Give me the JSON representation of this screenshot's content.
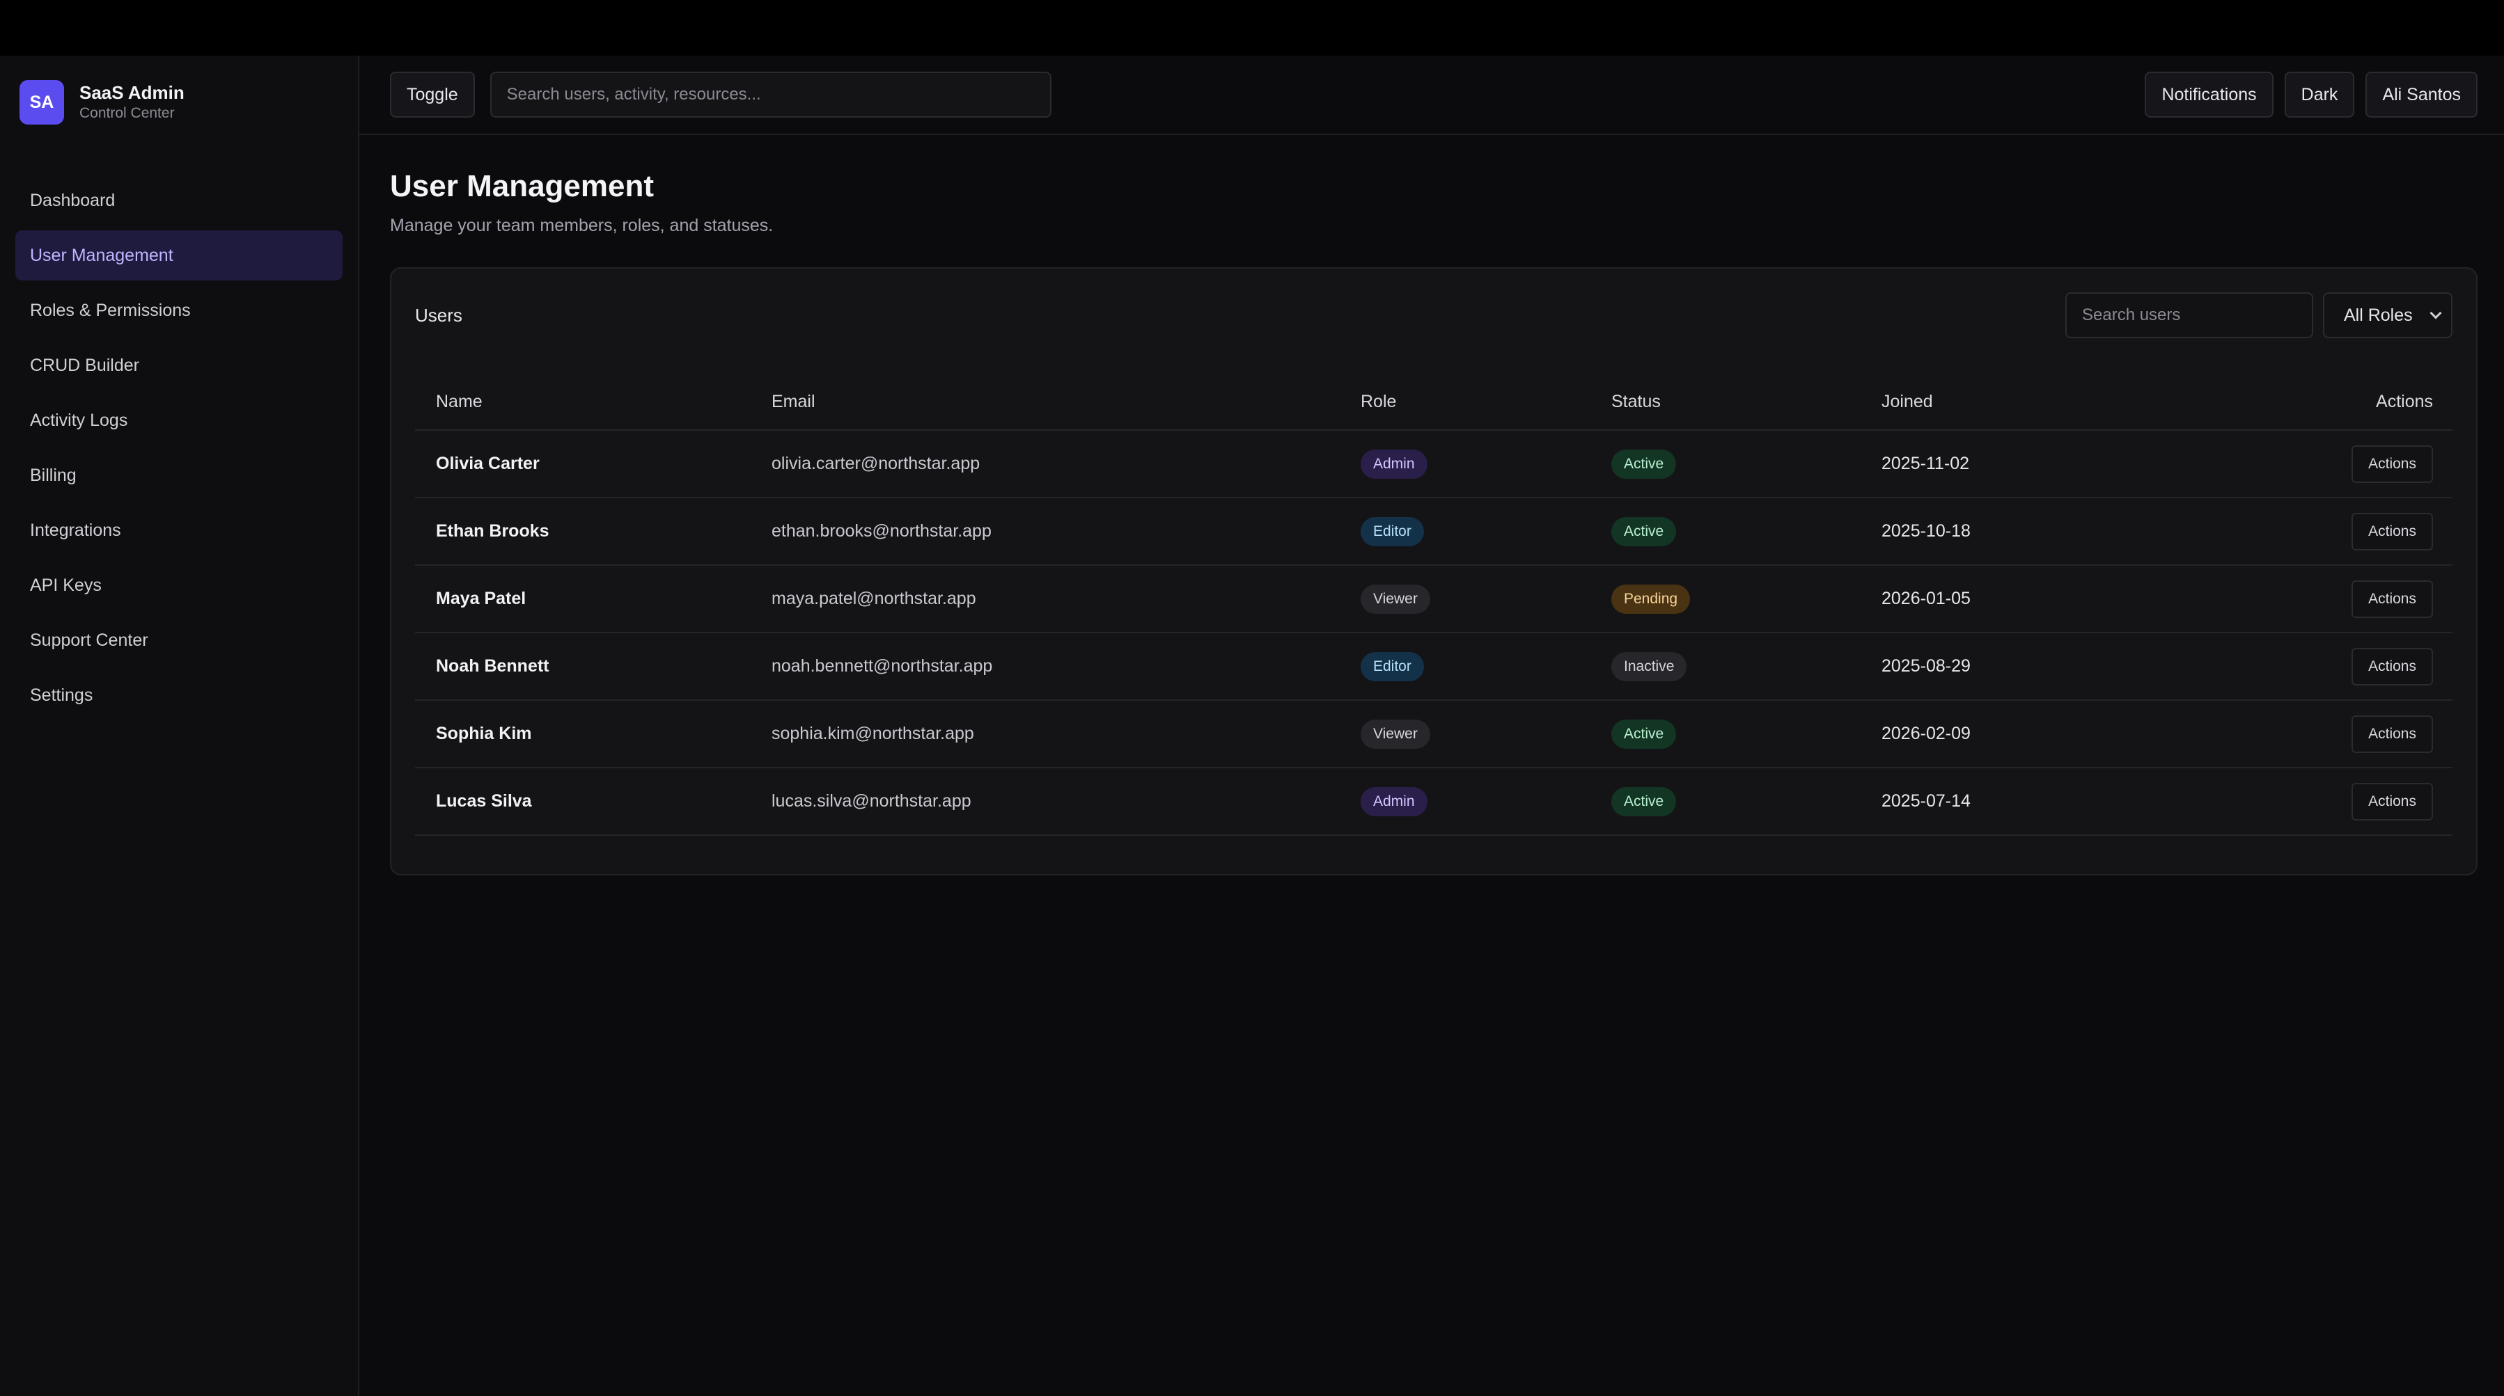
{
  "brand": {
    "logo": "SA",
    "title": "SaaS Admin",
    "subtitle": "Control Center"
  },
  "sidebar": {
    "items": [
      {
        "label": "Dashboard",
        "active": false
      },
      {
        "label": "User Management",
        "active": true
      },
      {
        "label": "Roles & Permissions",
        "active": false
      },
      {
        "label": "CRUD Builder",
        "active": false
      },
      {
        "label": "Activity Logs",
        "active": false
      },
      {
        "label": "Billing",
        "active": false
      },
      {
        "label": "Integrations",
        "active": false
      },
      {
        "label": "API Keys",
        "active": false
      },
      {
        "label": "Support Center",
        "active": false
      },
      {
        "label": "Settings",
        "active": false
      }
    ]
  },
  "header": {
    "toggle_label": "Toggle",
    "search_placeholder": "Search users, activity, resources...",
    "notifications_label": "Notifications",
    "theme_label": "Dark",
    "user_label": "Ali Santos"
  },
  "page": {
    "title": "User Management",
    "subtitle": "Manage your team members, roles, and statuses."
  },
  "card": {
    "title": "Users",
    "search_placeholder": "Search users",
    "role_filter": "All Roles"
  },
  "table": {
    "columns": [
      "Name",
      "Email",
      "Role",
      "Status",
      "Joined",
      "Actions"
    ],
    "rows": [
      {
        "name": "Olivia Carter",
        "email": "olivia.carter@northstar.app",
        "role": "Admin",
        "status": "Active",
        "joined": "2025-11-02",
        "action": "Actions"
      },
      {
        "name": "Ethan Brooks",
        "email": "ethan.brooks@northstar.app",
        "role": "Editor",
        "status": "Active",
        "joined": "2025-10-18",
        "action": "Actions"
      },
      {
        "name": "Maya Patel",
        "email": "maya.patel@northstar.app",
        "role": "Viewer",
        "status": "Pending",
        "joined": "2026-01-05",
        "action": "Actions"
      },
      {
        "name": "Noah Bennett",
        "email": "noah.bennett@northstar.app",
        "role": "Editor",
        "status": "Inactive",
        "joined": "2025-08-29",
        "action": "Actions"
      },
      {
        "name": "Sophia Kim",
        "email": "sophia.kim@northstar.app",
        "role": "Viewer",
        "status": "Active",
        "joined": "2026-02-09",
        "action": "Actions"
      },
      {
        "name": "Lucas Silva",
        "email": "lucas.silva@northstar.app",
        "role": "Admin",
        "status": "Active",
        "joined": "2025-07-14",
        "action": "Actions"
      }
    ]
  },
  "colors": {
    "accent": "#5b4cf0",
    "active_nav_bg": "#1e1b3f",
    "background": "#0b0b0d"
  }
}
